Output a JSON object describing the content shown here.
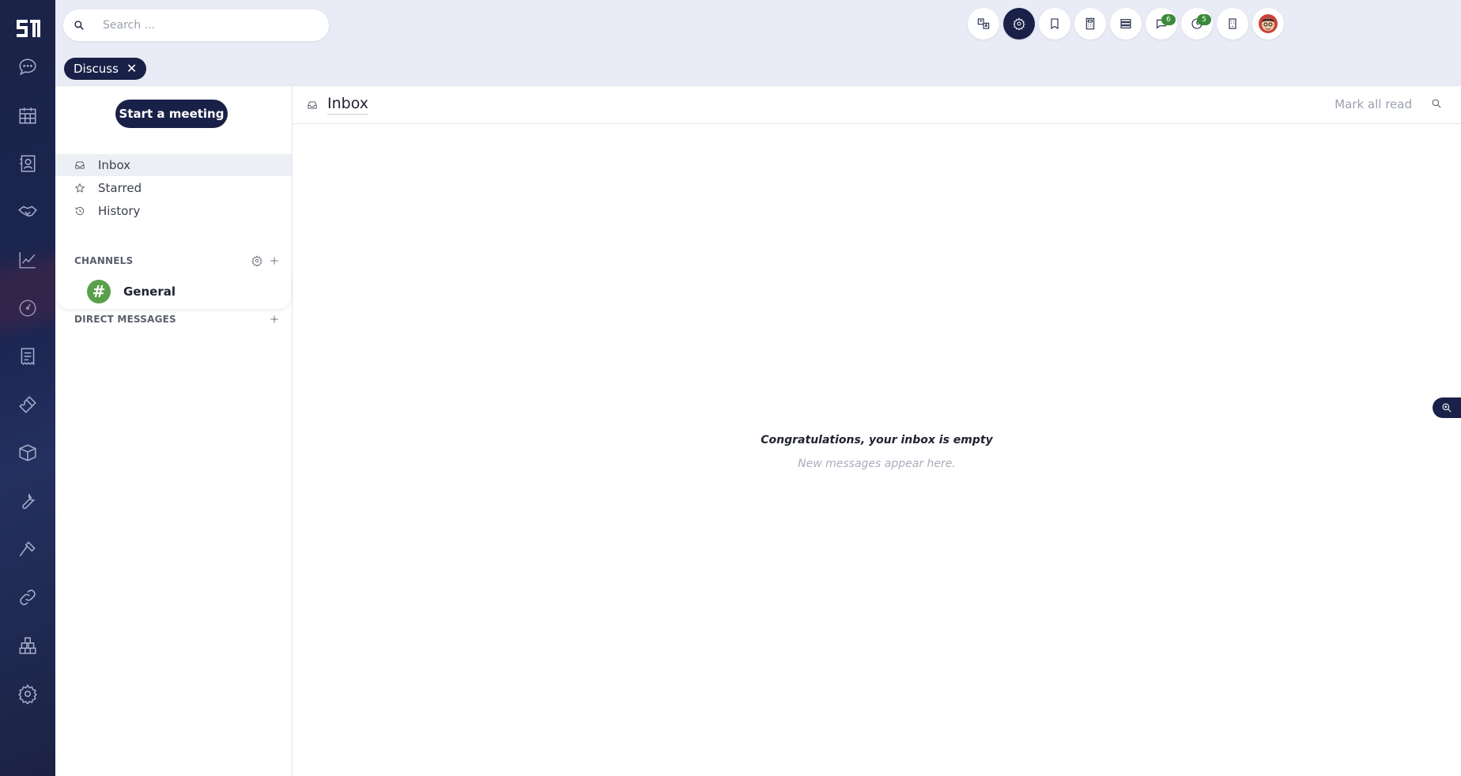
{
  "search": {
    "placeholder": "Search ..."
  },
  "breadcrumb": {
    "label": "Discuss",
    "close": "✕"
  },
  "sidebar": {
    "meeting_button": "Start a meeting",
    "nav": [
      {
        "label": "Inbox",
        "icon": "inbox-icon"
      },
      {
        "label": "Starred",
        "icon": "star-icon"
      },
      {
        "label": "History",
        "icon": "history-icon"
      }
    ],
    "channels_heading": "CHANNELS",
    "channels": [
      {
        "name": "General",
        "symbol": "#",
        "color": "#5aa04a"
      }
    ],
    "dm_heading": "DIRECT MESSAGES"
  },
  "topbar": {
    "badges": {
      "messages": "6",
      "activities": "5"
    }
  },
  "content": {
    "title": "Inbox",
    "mark_all_read": "Mark all read",
    "empty_title": "Congratulations, your inbox is empty",
    "empty_subtitle": "New messages appear here."
  },
  "colors": {
    "accent": "#1a2148",
    "channel": "#5aa04a",
    "badge": "#3a8a3a"
  }
}
